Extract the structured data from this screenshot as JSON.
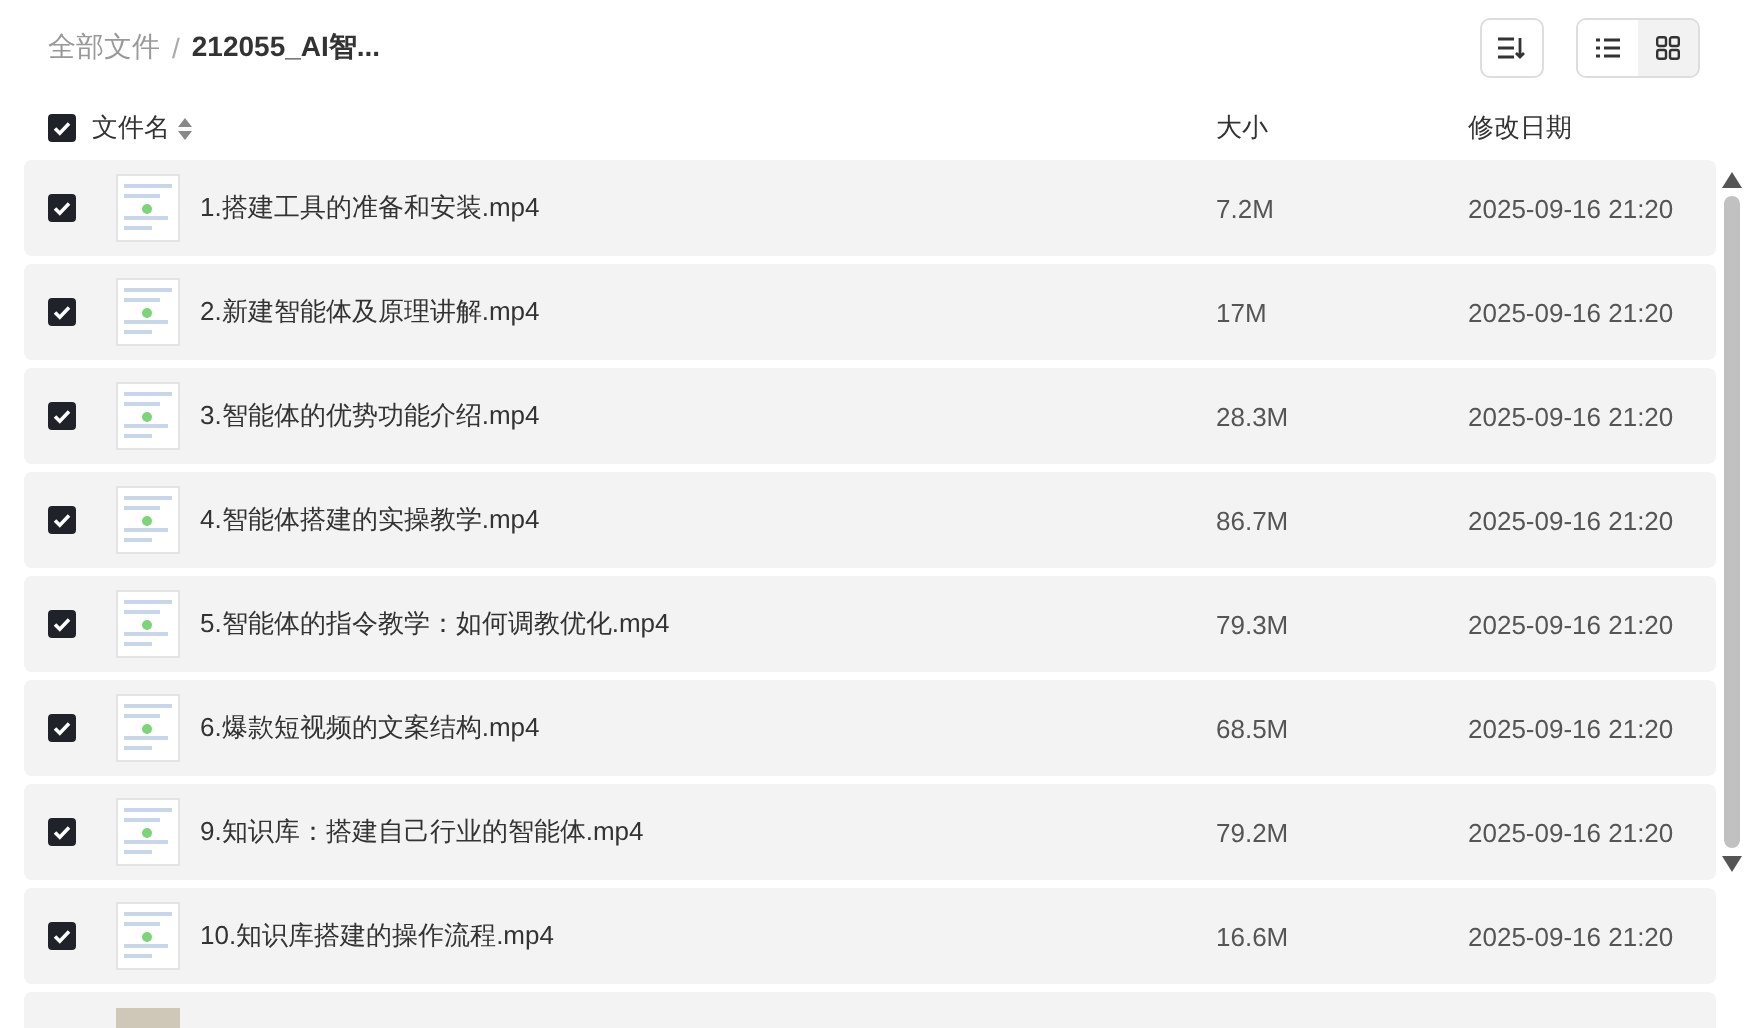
{
  "breadcrumb": [
    {
      "label": "全部文件",
      "current": false
    },
    {
      "label": "212055_AI智...",
      "current": true
    }
  ],
  "breadcrumb_separator": "/",
  "view_modes": [
    {
      "kind": "list",
      "selected": true
    },
    {
      "kind": "grid",
      "selected": false
    }
  ],
  "header": {
    "checked": true,
    "columns": [
      "文件名",
      "大小",
      "修改日期"
    ]
  },
  "rows": [
    {
      "kind": "file",
      "checked": true,
      "name": "1.搭建工具的准备和安装.mp4",
      "size": "7.2M",
      "date": "2025-09-16 21:20"
    },
    {
      "kind": "file",
      "checked": true,
      "name": "2.新建智能体及原理讲解.mp4",
      "size": "17M",
      "date": "2025-09-16 21:20"
    },
    {
      "kind": "file",
      "checked": true,
      "name": "3.智能体的优势功能介绍.mp4",
      "size": "28.3M",
      "date": "2025-09-16 21:20"
    },
    {
      "kind": "file",
      "checked": true,
      "name": "4.智能体搭建的实操教学.mp4",
      "size": "86.7M",
      "date": "2025-09-16 21:20"
    },
    {
      "kind": "file",
      "checked": true,
      "name": "5.智能体的指令教学：如何调教优化.mp4",
      "size": "79.3M",
      "date": "2025-09-16 21:20"
    },
    {
      "kind": "file",
      "checked": true,
      "name": "6.爆款短视频的文案结构.mp4",
      "size": "68.5M",
      "date": "2025-09-16 21:20"
    },
    {
      "kind": "file",
      "checked": true,
      "name": "9.知识库：搭建自己行业的智能体.mp4",
      "size": "79.2M",
      "date": "2025-09-16 21:20"
    },
    {
      "kind": "file",
      "checked": true,
      "name": "10.知识库搭建的操作流程.mp4",
      "size": "16.6M",
      "date": "2025-09-16 21:20"
    },
    {
      "kind": "clipped"
    }
  ]
}
